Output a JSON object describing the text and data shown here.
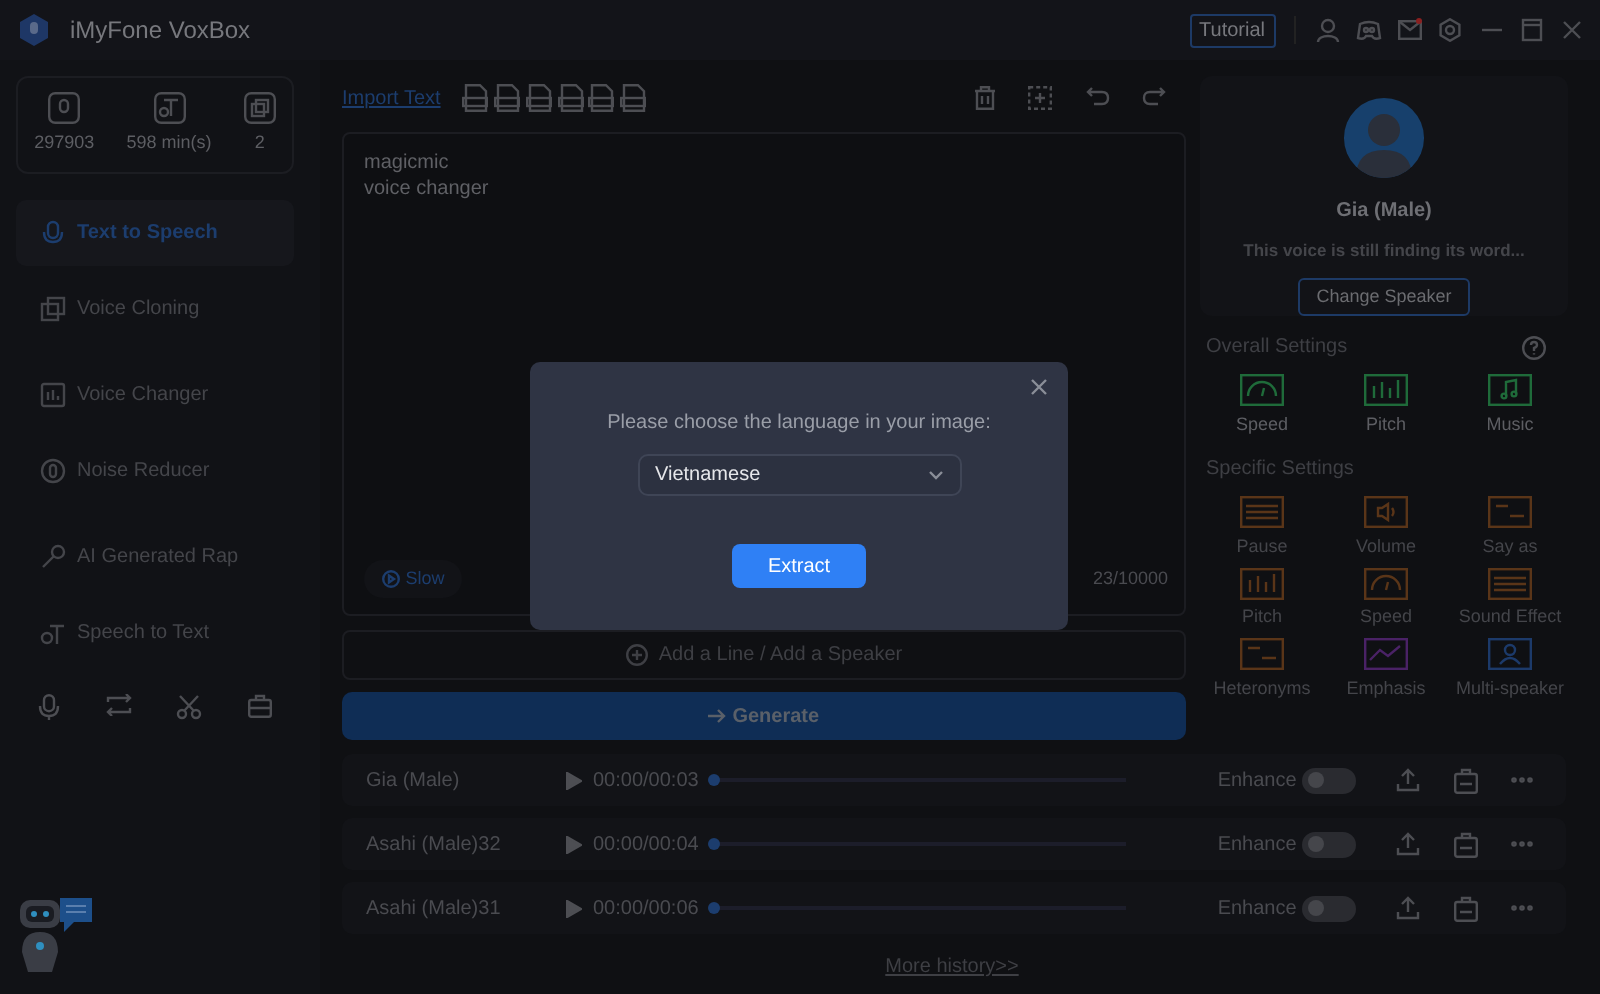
{
  "window": {
    "title": "iMyFone VoxBox",
    "tutorial": "Tutorial"
  },
  "stats": [
    {
      "kind": "characters",
      "value": "297903"
    },
    {
      "kind": "minutes",
      "value": "598 min(s)"
    },
    {
      "kind": "clones",
      "value": "2"
    }
  ],
  "sidebar": {
    "items": [
      {
        "kind": "tts",
        "label": "Text to Speech",
        "selected": true
      },
      {
        "kind": "clone",
        "label": "Voice Cloning",
        "selected": false
      },
      {
        "kind": "changer",
        "label": "Voice Changer",
        "selected": false
      },
      {
        "kind": "noise",
        "label": "Noise Reducer",
        "selected": false
      },
      {
        "kind": "rap",
        "label": "AI Generated Rap",
        "selected": false
      },
      {
        "kind": "stt",
        "label": "Speech to Text",
        "selected": false
      }
    ]
  },
  "editor": {
    "import_text": "Import Text",
    "lines": [
      "magicmic",
      "voice changer"
    ],
    "speed_button": "Slow",
    "char_count": "23/10000",
    "add_line": "Add a Line / Add a Speaker",
    "generate": "Generate"
  },
  "speaker": {
    "name": "Gia (Male)",
    "status": "This voice is still finding its word...",
    "change_button": "Change Speaker"
  },
  "overall_settings": {
    "title": "Overall Settings",
    "items": [
      {
        "kind": "gauge",
        "label": "Speed",
        "color": "#1f6b3a"
      },
      {
        "kind": "bars",
        "label": "Pitch",
        "color": "#1f6b3a"
      },
      {
        "kind": "music",
        "label": "Music",
        "color": "#1f6b3a"
      }
    ]
  },
  "specific_settings": {
    "title": "Specific Settings",
    "items": [
      {
        "kind": "lines",
        "label": "Pause",
        "color": "#5a3518"
      },
      {
        "kind": "volume",
        "label": "Volume",
        "color": "#5a3518"
      },
      {
        "kind": "abc",
        "label": "Say as",
        "color": "#5a3518"
      },
      {
        "kind": "bars",
        "label": "Pitch",
        "color": "#5a3518"
      },
      {
        "kind": "gauge",
        "label": "Speed",
        "color": "#5a3518"
      },
      {
        "kind": "lines",
        "label": "Sound Effect",
        "color": "#5a3518"
      },
      {
        "kind": "abc",
        "label": "Heteronyms",
        "color": "#5a3518"
      },
      {
        "kind": "emphasis",
        "label": "Emphasis",
        "color": "#4a2266"
      },
      {
        "kind": "people",
        "label": "Multi-speaker",
        "color": "#1c3a6a"
      }
    ]
  },
  "history": {
    "rows": [
      {
        "name": "Gia (Male)",
        "time": "00:00/00:03",
        "level": 0,
        "enhance_label": "Enhance",
        "enhance_on": false
      },
      {
        "name": "Asahi (Male)32",
        "time": "00:00/00:04",
        "level": 0,
        "enhance_label": "Enhance",
        "enhance_on": false
      },
      {
        "name": "Asahi (Male)31",
        "time": "00:00/00:06",
        "level": 0,
        "enhance_label": "Enhance",
        "enhance_on": false
      }
    ],
    "more": "More history>>"
  },
  "dialog": {
    "prompt": "Please choose the language in your image:",
    "language": "Vietnamese",
    "extract": "Extract"
  }
}
